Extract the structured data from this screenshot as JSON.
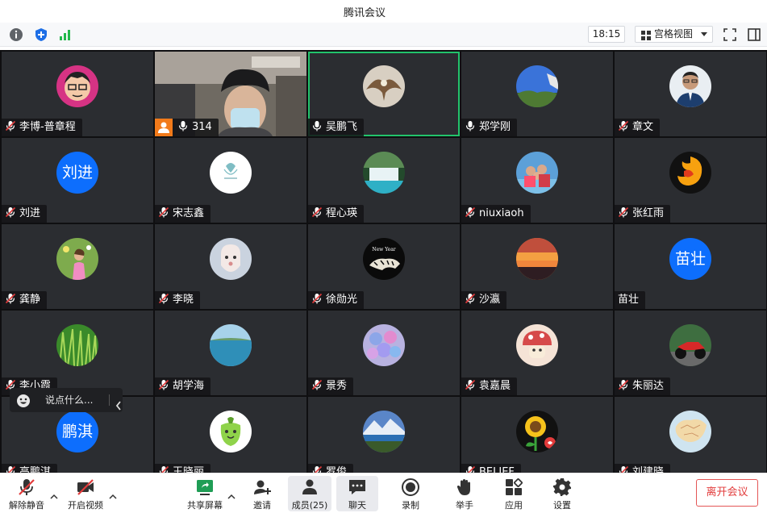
{
  "window": {
    "title": "腾讯会议"
  },
  "infobar": {
    "clock": "18:15",
    "view_mode": "宫格视图"
  },
  "colors": {
    "active_speaker": "#22c36b",
    "text_avatar": "#0d6efd",
    "leave": "#e23b3b"
  },
  "participants": [
    {
      "name": "李博-普章程",
      "muted": true,
      "avatar": "cartoon-man"
    },
    {
      "name": "314",
      "muted": false,
      "avatar": "video",
      "host": true
    },
    {
      "name": "吴鹏飞",
      "muted": false,
      "avatar": "eagle",
      "active": true
    },
    {
      "name": "郑学刚",
      "muted": false,
      "avatar": "blue-sky"
    },
    {
      "name": "章文",
      "muted": true,
      "avatar": "man-photo"
    },
    {
      "name": "刘进",
      "muted": true,
      "avatar_text": "刘进"
    },
    {
      "name": "宋志鑫",
      "muted": true,
      "avatar": "white-logo"
    },
    {
      "name": "程心瑛",
      "muted": true,
      "avatar": "waterfall"
    },
    {
      "name": "niuxiaoh",
      "muted": true,
      "avatar": "family-photo"
    },
    {
      "name": "张红雨",
      "muted": true,
      "avatar": "dragon"
    },
    {
      "name": "龚静",
      "muted": true,
      "avatar": "girl-flowers"
    },
    {
      "name": "李晓",
      "muted": true,
      "avatar": "dog-photo"
    },
    {
      "name": "徐勋光",
      "muted": true,
      "avatar": "tiger-black"
    },
    {
      "name": "沙瀛",
      "muted": true,
      "avatar": "sunset"
    },
    {
      "name": "苗壮",
      "muted": false,
      "no_mic": true,
      "avatar_text": "苗壮"
    },
    {
      "name": "李小霞",
      "muted": true,
      "avatar": "grass"
    },
    {
      "name": "胡学海",
      "muted": true,
      "avatar": "sea"
    },
    {
      "name": "景秀",
      "muted": true,
      "avatar": "hydrangea"
    },
    {
      "name": "袁嘉晨",
      "muted": true,
      "avatar": "cartoon-mushroom"
    },
    {
      "name": "朱丽达",
      "muted": true,
      "avatar": "motorcycle"
    },
    {
      "name": "高鹏淇",
      "muted": true,
      "avatar_text": "鹏淇"
    },
    {
      "name": "王晓丽",
      "muted": true,
      "avatar": "cartoon-pepper"
    },
    {
      "name": "罗俊",
      "muted": true,
      "avatar": "mountain-lake"
    },
    {
      "name": "BELIEF",
      "muted": true,
      "avatar": "sunflower"
    },
    {
      "name": "刘建晓",
      "muted": true,
      "avatar": "map"
    }
  ],
  "chat": {
    "placeholder": "说点什么..."
  },
  "toolbar": {
    "unmute": "解除静音",
    "video": "开启视频",
    "share": "共享屏幕",
    "invite": "邀请",
    "members": "成员(25)",
    "chat": "聊天",
    "record": "录制",
    "raise_hand": "举手",
    "apps": "应用",
    "settings": "设置",
    "leave": "离开会议"
  }
}
